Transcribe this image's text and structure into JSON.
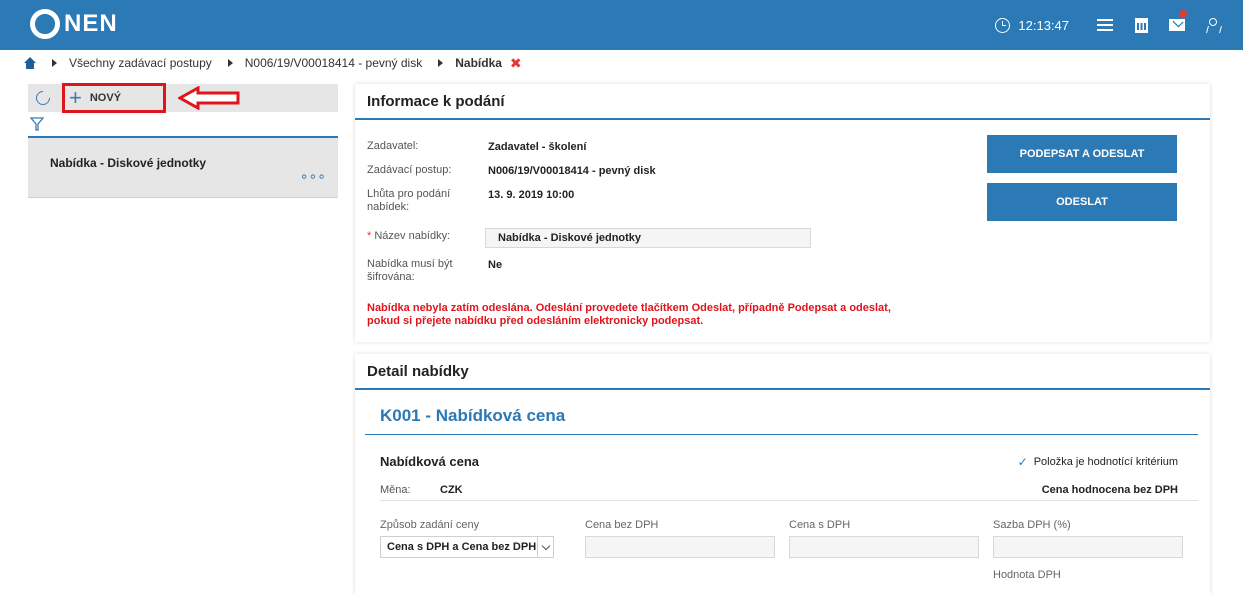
{
  "header": {
    "logo_text": "NEN",
    "time": "12:13:47",
    "icons": [
      "clock-icon",
      "menu-icon",
      "calculator-icon",
      "mail-icon",
      "user-icon"
    ],
    "brand_color": "#2b79b5",
    "notification_color": "#e53935"
  },
  "breadcrumb": {
    "items": [
      "Všechny zadávací postupy",
      "N006/19/V00018414 - pevný disk",
      "Nabídka"
    ],
    "close_symbol": "✖"
  },
  "sidebar": {
    "new_label": "NOVÝ",
    "list": [
      {
        "title": "Nabídka - Diskové jednotky",
        "more": "∘∘∘"
      }
    ]
  },
  "info": {
    "title": "Informace k podání",
    "rows": [
      {
        "label": "Zadavatel:",
        "value": "Zadavatel - školení"
      },
      {
        "label": "Zadávací postup:",
        "value": "N006/19/V00018414 - pevný disk"
      },
      {
        "label": "Lhůta pro podání nabídek:",
        "value": "13. 9. 2019 10:00"
      },
      {
        "label_required": "*",
        "label": "Název nabídky:",
        "value": "Nabídka - Diskové jednotky"
      },
      {
        "label": "Nabídka musí být šifrována:",
        "value": "Ne"
      }
    ],
    "warning_line1": "Nabídka nebyla zatím odeslána. Odeslání provedete tlačítkem Odeslat, případně Podepsat a odeslat,",
    "warning_line2": "pokud si přejete nabídku před odesláním elektronicky podepsat.",
    "sign_send_label": "PODEPSAT A ODESLAT",
    "send_label": "ODESLAT",
    "warning_color": "#e0141b"
  },
  "detail": {
    "title": "Detail nabídky",
    "section_title": "K001 - Nabídková cena",
    "price_title": "Nabídková cena",
    "criterion_label": "Položka je hodnotící kritérium",
    "currency_label": "Měna:",
    "currency_value": "CZK",
    "evaluated_note": "Cena hodnocena bez DPH",
    "fields": {
      "method_label": "Způsob zadání ceny",
      "method_value": "Cena s DPH a Cena bez DPH",
      "price_without_vat_label": "Cena bez DPH",
      "price_with_vat_label": "Cena s DPH",
      "vat_rate_label": "Sazba DPH (%)",
      "vat_value_label": "Hodnota DPH"
    }
  }
}
